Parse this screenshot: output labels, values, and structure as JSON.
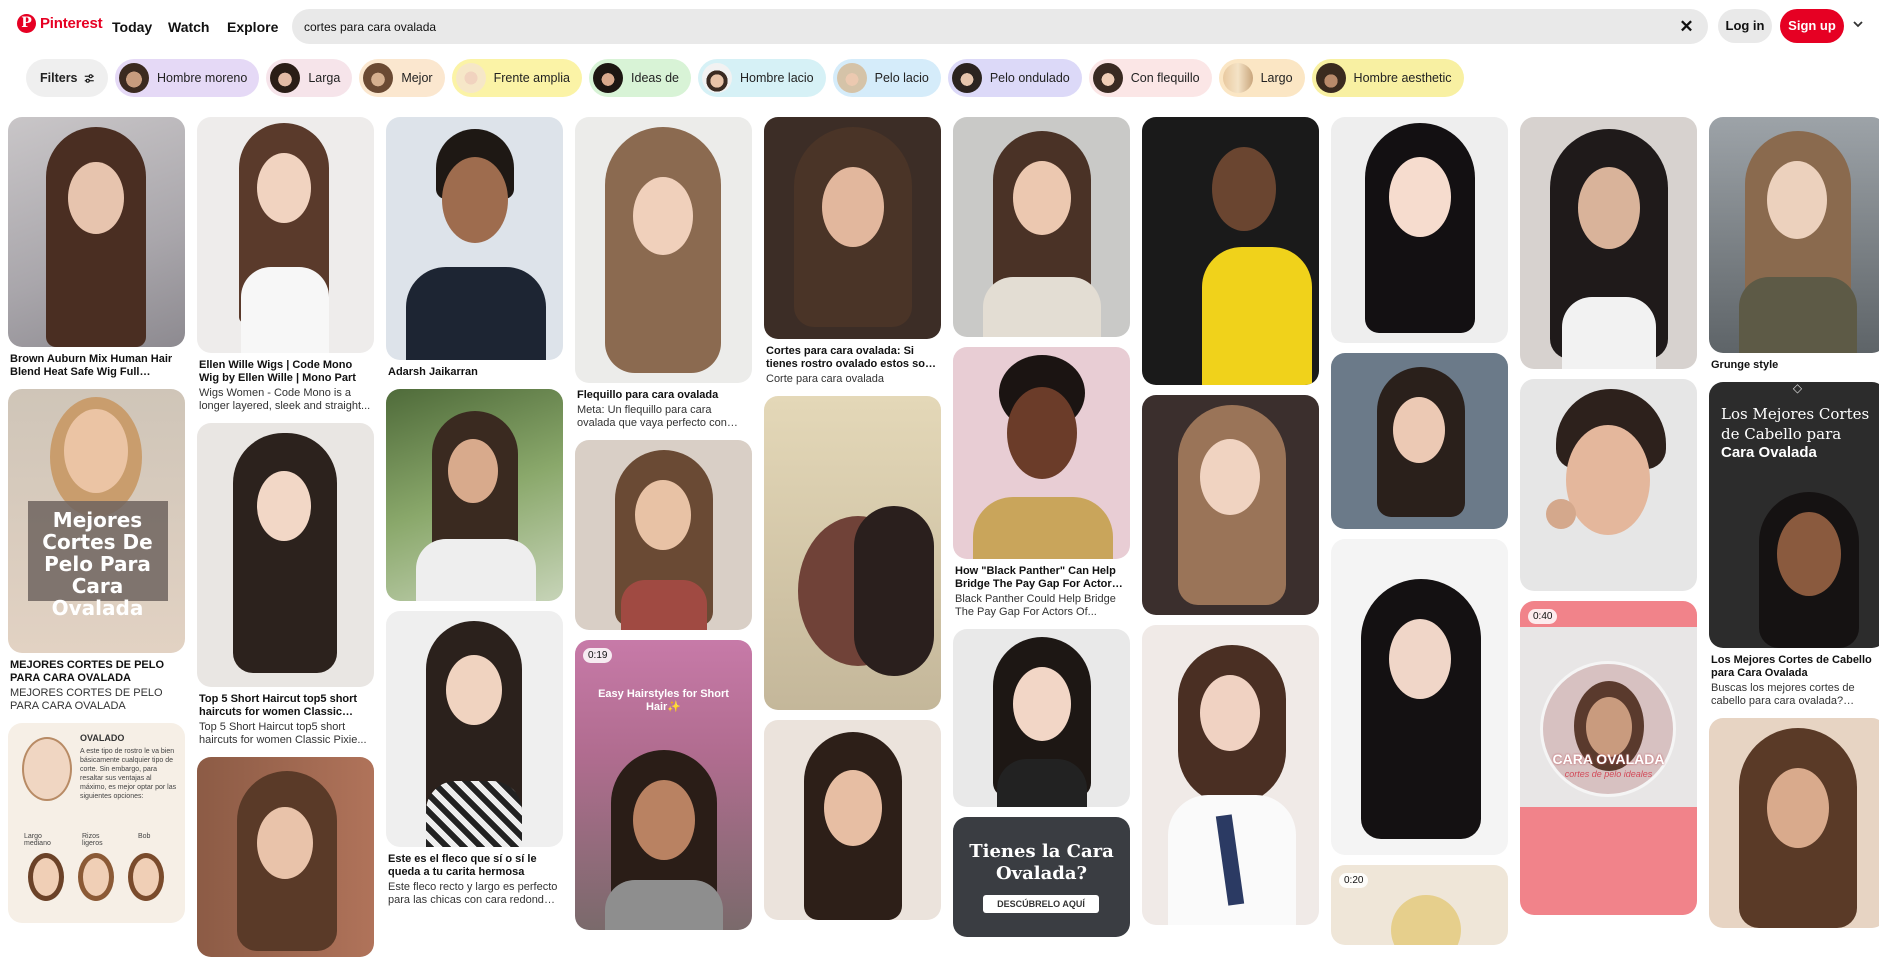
{
  "header": {
    "logo_text": "Pinterest",
    "nav": [
      "Today",
      "Watch",
      "Explore"
    ],
    "search_value": "cortes para cara ovalada",
    "login": "Log in",
    "signup": "Sign up"
  },
  "filters": {
    "label": "Filters",
    "chips": [
      {
        "label": "Hombre moreno",
        "bg": "#e5d9f6"
      },
      {
        "label": "Larga",
        "bg": "#f6e4ea"
      },
      {
        "label": "Mejor",
        "bg": "#fbe7cf"
      },
      {
        "label": "Frente amplia",
        "bg": "#fbf3a6"
      },
      {
        "label": "Ideas de",
        "bg": "#d8f3d6"
      },
      {
        "label": "Hombre lacio",
        "bg": "#d6f1f6"
      },
      {
        "label": "Pelo lacio",
        "bg": "#d5ecfa"
      },
      {
        "label": "Pelo ondulado",
        "bg": "#dcd9f8"
      },
      {
        "label": "Con flequillo",
        "bg": "#fbe6e6"
      },
      {
        "label": "Largo",
        "bg": "#fbe6c4"
      },
      {
        "label": "Hombre aesthetic",
        "bg": "#f8f0a2"
      }
    ]
  },
  "pins": {
    "c1p1_title": "Brown Auburn Mix Human Hair Blend Heat Safe Wig Full Bangs...",
    "c1p2_overlay": "Mejores Cortes De Pelo Para Cara Ovalada",
    "c1p2_title": "MEJORES CORTES DE PELO PARA CARA OVALADA",
    "c1p2_desc": "MEJORES CORTES DE PELO PARA CARA OVALADA",
    "c1p3_heading": "OVALADO",
    "c1p3_body": "A este tipo de rostro le va bien básicamente cualquier tipo de corte. Sin embargo, para resaltar sus ventajas al máximo, es mejor optar por las siguientes opciones:",
    "c1p3_labels": [
      "Largo mediano",
      "Rizos ligeros",
      "Bob"
    ],
    "c2p1_title": "Ellen Wille Wigs | Code Mono Wig by Ellen Wille | Mono Part",
    "c2p1_desc": "Wigs Women - Code Mono is a longer layered, sleek and straight...",
    "c2p2_title": "Top 5 Short Haircut top5 short haircuts for women Classic Pixie...",
    "c2p2_desc": "Top 5 Short Haircut top5 short haircuts for women Classic Pixie...",
    "c3p1_title": "Adarsh Jaikarran",
    "c3p3_title": "Este es el fleco que sí o sí le queda a tu carita hermosa",
    "c3p3_desc": "Este fleco recto y largo es perfecto para las chicas con cara redonda u...",
    "c4p1_title": "Flequillo para cara ovalada",
    "c4p1_desc": "Meta: Un flequillo para cara ovalada que vaya perfecto con este tipo de...",
    "c4p3_badge": "0:19",
    "c4p3_overlay": "Easy Hairstyles for Short Hair✨",
    "c5p1_title": "Cortes para cara ovalada: Si tienes rostro ovalado estos son para ti |...",
    "c5p1_desc": "Corte para cara ovalada",
    "c6p2_title": "How \"Black Panther\" Can Help Bridge The Pay Gap For Actors Of...",
    "c6p2_desc": "Black Panther Could Help Bridge The Pay Gap For Actors Of...",
    "c6p4_overlay": "Tienes la Cara Ovalada?",
    "c6p4_button": "DESCÚBRELO AQUÍ",
    "c8p3_badge": "0:20",
    "c9p3_badge": "0:40",
    "c9p3_overlay": "CARA OVALADA",
    "c9p3_sub": "cortes de pelo ideales",
    "c10p1_title": "Grunge style",
    "c10p2_overlay1": "Los Mejores Cortes de Cabello para",
    "c10p2_overlay2": "Cara Ovalada",
    "c10p2_title": "Los Mejores Cortes de Cabello para Cara Ovalada",
    "c10p2_desc": "Buscas los mejores cortes de cabello para cara ovalada? Aprende aquí..."
  },
  "colors": {
    "brand": "#e60023"
  }
}
